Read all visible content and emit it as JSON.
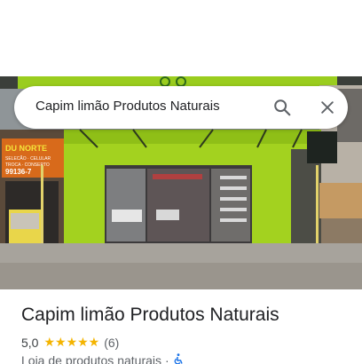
{
  "search": {
    "query": "Capim limão Produtos Naturais",
    "search_icon": "search-icon",
    "close_icon": "close-icon"
  },
  "photo": {
    "signage_left_lines": [
      "DU NORTE",
      "SELECÃO · CELULAR",
      "TROCA · CONSERTO",
      "99136-7"
    ]
  },
  "place": {
    "title": "Capim limão Produtos Naturais",
    "rating": "5,0",
    "stars": "★★★★★",
    "review_count": "(6)",
    "category": "Loja de produtos naturais",
    "separator": "·",
    "accessibility_icon": "wheelchair-icon"
  },
  "colors": {
    "storefront_green": "#9acd1e",
    "star_yellow": "#f4b400",
    "accessibility_blue": "#1a73e8"
  }
}
